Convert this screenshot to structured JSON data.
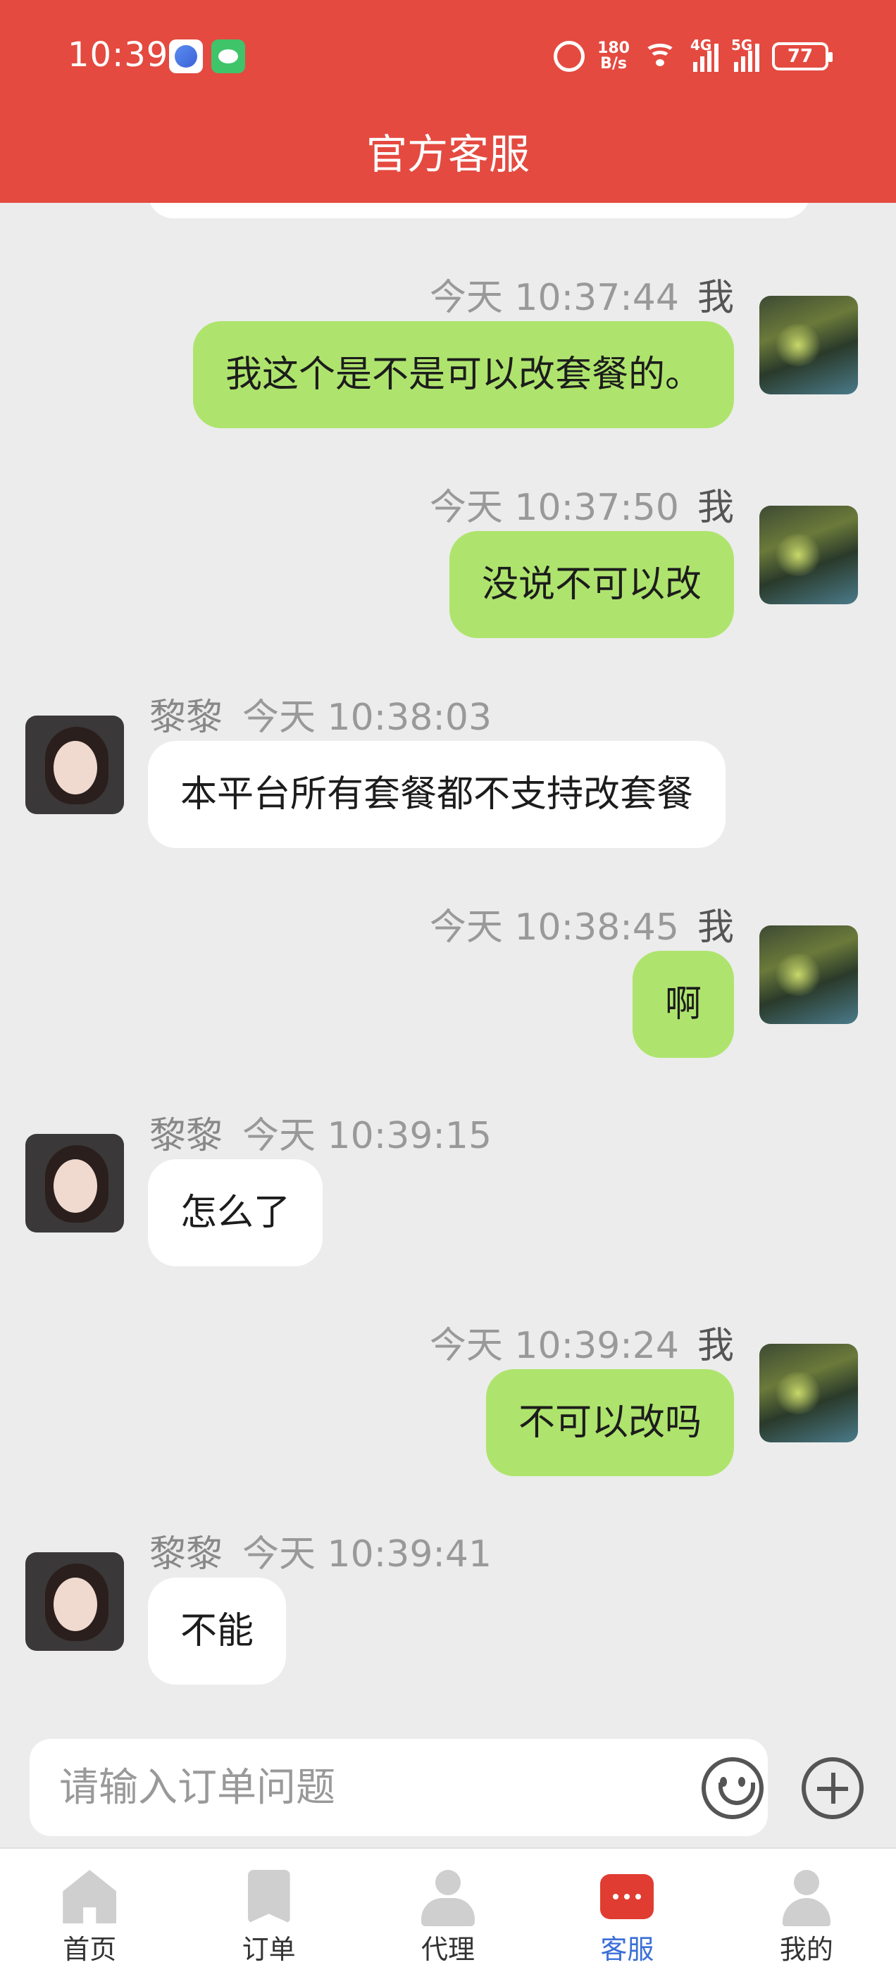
{
  "status_bar": {
    "time": "10:39",
    "net_speed_value": "180",
    "net_speed_unit": "B/s",
    "signal1_label": "4G",
    "signal2_label": "5G",
    "battery": "77"
  },
  "header": {
    "title": "官方客服"
  },
  "messages": [
    {
      "side": "out",
      "time": "今天 10:37:44",
      "sender": "我",
      "text": "我这个是不是可以改套餐的。"
    },
    {
      "side": "out",
      "time": "今天 10:37:50",
      "sender": "我",
      "text": "没说不可以改"
    },
    {
      "side": "in",
      "name": "黎黎",
      "time": "今天 10:38:03",
      "text": "本平台所有套餐都不支持改套餐"
    },
    {
      "side": "out",
      "time": "今天 10:38:45",
      "sender": "我",
      "text": "啊"
    },
    {
      "side": "in",
      "name": "黎黎",
      "time": "今天 10:39:15",
      "text": "怎么了"
    },
    {
      "side": "out",
      "time": "今天 10:39:24",
      "sender": "我",
      "text": "不可以改吗"
    },
    {
      "side": "in",
      "name": "黎黎",
      "time": "今天 10:39:41",
      "text": "不能"
    }
  ],
  "input": {
    "placeholder": "请输入订单问题"
  },
  "nav": [
    {
      "label": "首页"
    },
    {
      "label": "订单"
    },
    {
      "label": "代理"
    },
    {
      "label": "客服"
    },
    {
      "label": "我的"
    }
  ],
  "colors": {
    "header": "#e44a40",
    "outgoing_bubble": "#aee46d",
    "incoming_bubble": "#ffffff",
    "active_nav": "#3b6fd8"
  }
}
